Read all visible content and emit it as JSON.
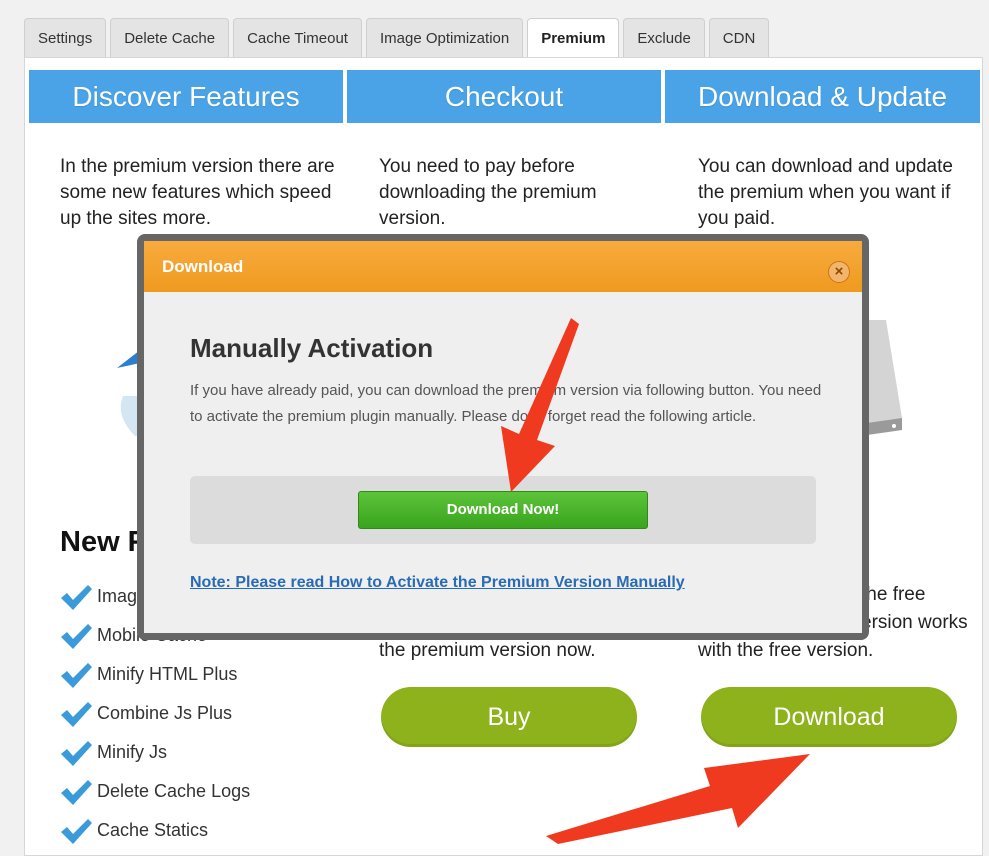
{
  "tabs": [
    {
      "label": "Settings",
      "active": false
    },
    {
      "label": "Delete Cache",
      "active": false
    },
    {
      "label": "Cache Timeout",
      "active": false
    },
    {
      "label": "Image Optimization",
      "active": false
    },
    {
      "label": "Premium",
      "active": true
    },
    {
      "label": "Exclude",
      "active": false
    },
    {
      "label": "CDN",
      "active": false
    }
  ],
  "columns": [
    {
      "header": "Discover Features",
      "text": "In the premium version there are some new features which speed up the sites more."
    },
    {
      "header": "Checkout",
      "text": "You need to pay before downloading the premium version."
    },
    {
      "header": "Download & Update",
      "text": "You can download and update the premium when you want if you paid."
    }
  ],
  "features": {
    "title": "New F",
    "items": [
      "Image",
      "Mobile Cache",
      "Minify HTML Plus",
      "Combine Js Plus",
      "Minify Js",
      "Delete Cache Logs",
      "Cache Statics"
    ]
  },
  "checkout_bottom_text": "the premium version now.",
  "download_bottom_text": {
    "line1": "the free",
    "line2": "ersion works",
    "line3": "with the free version."
  },
  "buttons": {
    "buy": "Buy",
    "download": "Download"
  },
  "modal": {
    "header": "Download",
    "close_label": "×",
    "title": "Manually Activation",
    "body": "If you have already paid, you can download the premium version via following button. You need to activate the premium plugin manually. Please don't forget read the following article.",
    "download_now": "Download Now!",
    "note_link": "Note: Please read How to Activate the Premium Version Manually"
  },
  "colors": {
    "header_blue": "#4aa3e6",
    "pill_green": "#8db21c",
    "modal_orange": "#f4a331",
    "button_green": "#4cb52e",
    "arrow_red": "#f03a1f",
    "check_blue": "#3b9ad9"
  }
}
